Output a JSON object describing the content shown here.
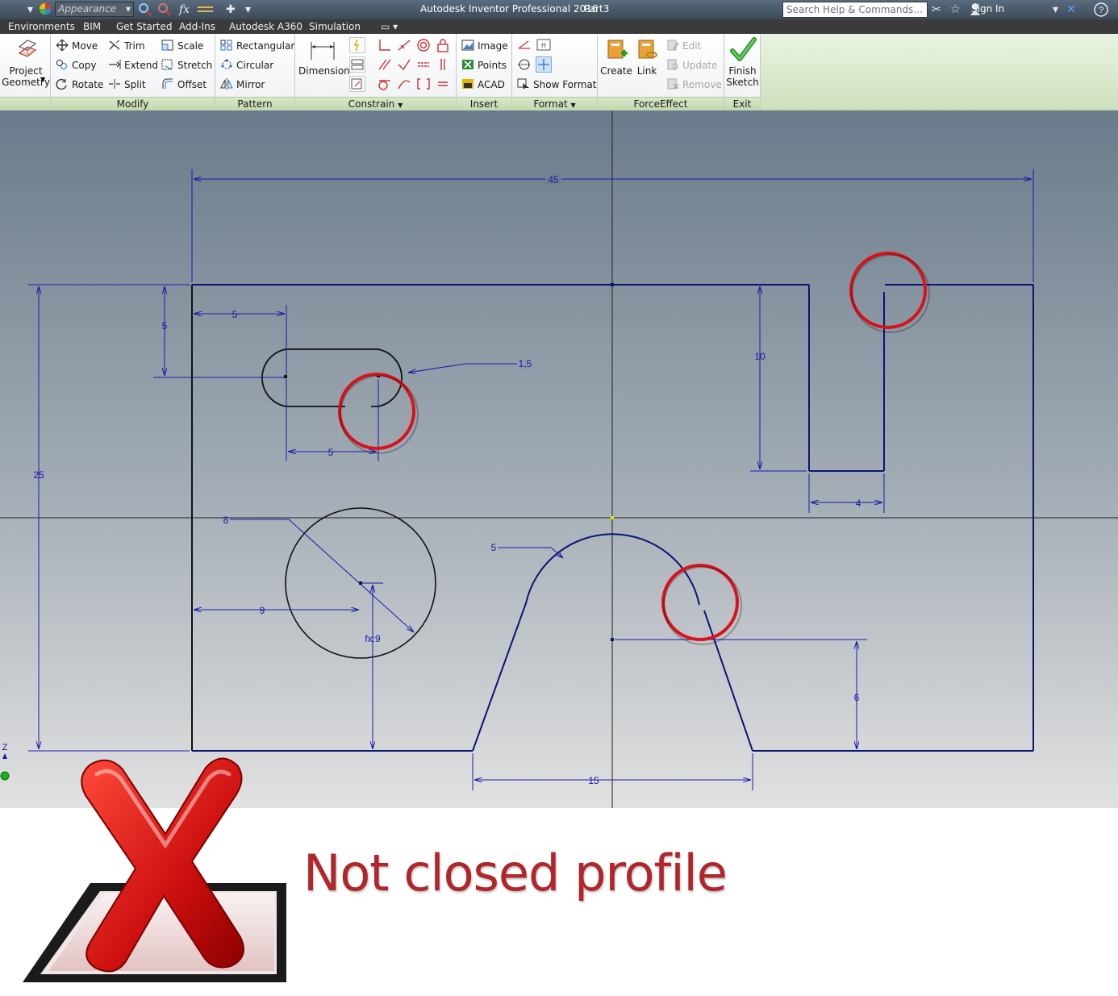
{
  "titlebar": {
    "appearance_placeholder": "Appearance",
    "fx_label": "fx",
    "title": "Autodesk Inventor Professional 2016",
    "document": "Part3",
    "search_placeholder": "Search Help & Commands...",
    "sign_in": "Sign In"
  },
  "menu": {
    "tabs": [
      "Environments",
      "BIM",
      "Get Started",
      "Add-Ins",
      "Autodesk A360",
      "Simulation"
    ]
  },
  "ribbon": {
    "project_geometry": [
      "Project",
      "Geometry"
    ],
    "modify": {
      "title": "Modify",
      "move": "Move",
      "copy": "Copy",
      "rotate": "Rotate",
      "trim": "Trim",
      "extend": "Extend",
      "split": "Split",
      "scale": "Scale",
      "stretch": "Stretch",
      "offset": "Offset"
    },
    "pattern": {
      "title": "Pattern",
      "rectangular": "Rectangular",
      "circular": "Circular",
      "mirror": "Mirror"
    },
    "constrain": {
      "title": "Constrain",
      "dimension": "Dimension"
    },
    "insert": {
      "title": "Insert",
      "image": "Image",
      "points": "Points",
      "acad": "ACAD"
    },
    "format": {
      "title": "Format",
      "show_format": "Show Format"
    },
    "forceeffect": {
      "title": "ForceEffect",
      "create": "Create",
      "link": "Link",
      "edit": "Edit",
      "update": "Update",
      "remove": "Remove"
    },
    "exit": {
      "title": "Exit",
      "finish": [
        "Finish",
        "Sketch"
      ]
    }
  },
  "sketch": {
    "dimensions": {
      "overall_width": "45",
      "overall_height": "25",
      "slot_top_offset": "5",
      "slot_left_offset": "5",
      "slot_length": "5",
      "slot_radius": "1,5",
      "notch_depth": "10",
      "notch_width": "4",
      "circle_diameter": "8",
      "circle_x": "9",
      "circle_y": "fx:9",
      "arc_radius": "5",
      "arc_height": "6",
      "arch_base": "15"
    },
    "axis_label": "Z"
  },
  "status": {
    "message": "Not closed profile"
  },
  "colors": {
    "sketch_line": "#000000",
    "dimension": "#1a1aa8",
    "highlight_circle": "#d8131b",
    "status_text": "#b0262a",
    "panel_title_bg": "#c2d8ae"
  }
}
